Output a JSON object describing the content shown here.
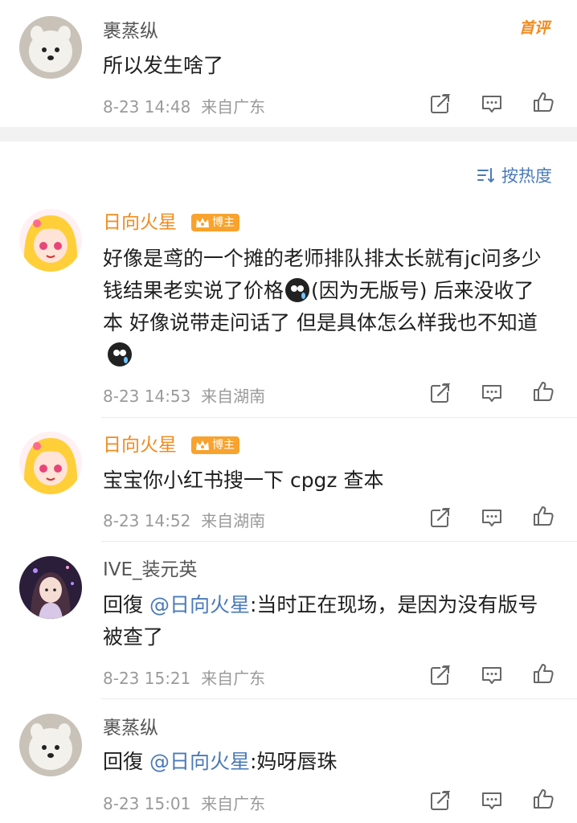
{
  "top_comment": {
    "user": "裹蒸纵",
    "tag": "首评",
    "text": "所以发生啥了",
    "time": "8-23 14:48",
    "source": "来自广东"
  },
  "sort": {
    "label": "按热度"
  },
  "replies": [
    {
      "user": "日向火星",
      "badge": "博主",
      "text": "好像是鸢的一个摊的老师排队排太长就有jc问多少钱结果老实说了价格",
      "text_b": "(因为无版号) 后来没收了本 好像说带走问话了 但是具体怎么样我也不知道",
      "time": "8-23 14:53",
      "source": "来自湖南"
    },
    {
      "user": "日向火星",
      "badge": "博主",
      "text": "宝宝你小红书搜一下 cpgz 查本",
      "time": "8-23 14:52",
      "source": "来自湖南"
    },
    {
      "user": "IVE_装元英",
      "reply_prefix": "回復",
      "mention": "@日向火星",
      "text": ":当时正在现场，是因为没有版号被查了",
      "time": "8-23 15:21",
      "source": "来自广东"
    },
    {
      "user": "裹蒸纵",
      "reply_prefix": "回復",
      "mention": "@日向火星",
      "text": ":妈呀唇珠",
      "time": "8-23 15:01",
      "source": "来自广东"
    }
  ],
  "icons": [
    "share-icon",
    "comment-icon",
    "like-icon",
    "sort-icon",
    "crown-icon"
  ],
  "colors": {
    "accent_orange": "#f08a1f",
    "mention_blue": "#4a7ab8",
    "meta_gray": "#9a9a9a"
  }
}
